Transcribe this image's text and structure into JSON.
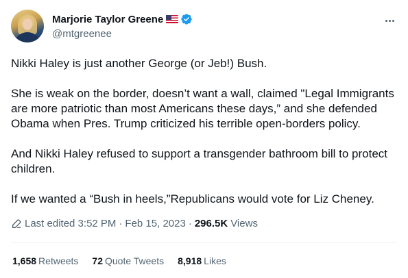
{
  "author": {
    "display_name": "Marjorie Taylor Greene",
    "handle": "@mtgreenee",
    "flag_icon": "us-flag-icon",
    "verified_icon": "verified-badge-icon",
    "verified_color": "#1d9bf0"
  },
  "tweet": {
    "paragraphs": [
      "Nikki Haley is just another George (or Jeb!) Bush.",
      "She is weak on the border, doesn’t want a wall, claimed \"Legal Immigrants are more patriotic than most Americans these days,” and she defended Obama when Pres. Trump criticized his terrible open-borders policy.",
      "And Nikki Haley refused to support a transgender bathroom bill to protect children.",
      "If we wanted a “Bush in heels,”Republicans would vote for Liz Cheney."
    ]
  },
  "meta": {
    "edited_label": "Last edited 3:52 PM",
    "separator": "·",
    "date": "Feb 15, 2023",
    "views_count": "296.5K",
    "views_label": "Views"
  },
  "stats": [
    {
      "count": "1,658",
      "label": "Retweets"
    },
    {
      "count": "72",
      "label": "Quote Tweets"
    },
    {
      "count": "8,918",
      "label": "Likes"
    }
  ]
}
